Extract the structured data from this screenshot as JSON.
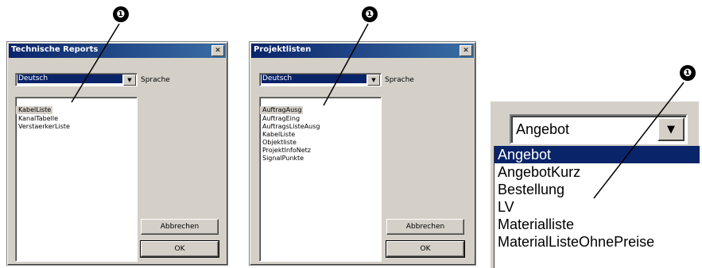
{
  "callouts": {
    "marker": "❶"
  },
  "dialog1": {
    "title": "Technische Reports",
    "close": "✕",
    "language": {
      "value": "Deutsch",
      "label": "Sprache"
    },
    "reports": [
      "KabelListe",
      "KanalTabelle",
      "VerstaerkerListe"
    ],
    "selected_index": 0,
    "cancel_label": "Abbrechen",
    "ok_label": "OK"
  },
  "dialog2": {
    "title": "Projektlisten",
    "close": "✕",
    "language": {
      "value": "Deutsch",
      "label": "Sprache"
    },
    "reports": [
      "AuftragAusg",
      "AuftragEing",
      "AuftragsListeAusg",
      "KabelListe",
      "Objektliste",
      "ProjektInfoNetz",
      "SignalPunkte"
    ],
    "selected_index": 0,
    "cancel_label": "Abbrechen",
    "ok_label": "OK"
  },
  "zoom": {
    "combo_value": "Angebot",
    "options": [
      "Angebot",
      "AngebotKurz",
      "Bestellung",
      "LV",
      "Materialliste",
      "MaterialListeOhnePreise"
    ],
    "selected_index": 0
  },
  "icons": {
    "dropdown": "chevron-down-icon",
    "close": "close-icon"
  }
}
